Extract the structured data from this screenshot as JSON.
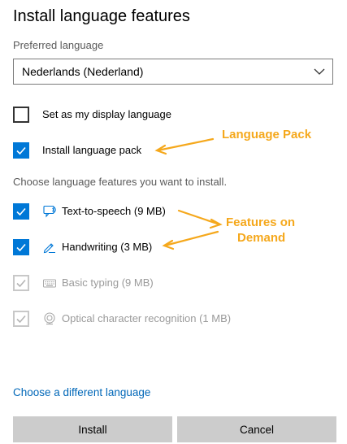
{
  "dialog": {
    "title": "Install language features",
    "preferred_label": "Preferred language",
    "preferred_value": "Nederlands (Nederland)",
    "display_language_label": "Set as my display language",
    "display_language_checked": false,
    "language_pack_label": "Install language pack",
    "language_pack_checked": true,
    "features_prompt": "Choose language features you want to install.",
    "features": [
      {
        "label": "Text-to-speech (9 MB)",
        "icon": "speech-icon",
        "checked": true,
        "enabled": true
      },
      {
        "label": "Handwriting (3 MB)",
        "icon": "pen-icon",
        "checked": true,
        "enabled": true
      },
      {
        "label": "Basic typing (9 MB)",
        "icon": "keyboard-icon",
        "checked": true,
        "enabled": false
      },
      {
        "label": "Optical character recognition (1 MB)",
        "icon": "ocr-icon",
        "checked": true,
        "enabled": false
      }
    ],
    "change_language_link": "Choose a different language",
    "install_button": "Install",
    "cancel_button": "Cancel"
  },
  "annotations": {
    "language_pack": "Language Pack",
    "features_line1": "Features on",
    "features_line2": "Demand",
    "color": "#f5a81c"
  },
  "colors": {
    "accent": "#0078d7",
    "link": "#0067b8",
    "button": "#cccccc"
  }
}
